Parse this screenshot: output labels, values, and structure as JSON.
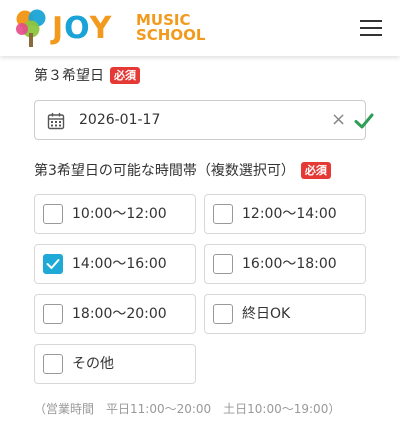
{
  "header": {
    "logo_main": [
      "J",
      "O",
      "Y"
    ],
    "logo_sub": [
      "MUSIC",
      "SCHOOL"
    ],
    "menu_icon": "hamburger-menu-icon"
  },
  "third_choice_date": {
    "label": "第３希望日",
    "required_badge": "必須",
    "value": "2026-01-17",
    "clear_label": "×",
    "calendar_icon": "calendar-icon",
    "valid_icon": "checkmark-icon"
  },
  "time_slots": {
    "label": "第3希望日の可能な時間帯（複数選択可）",
    "required_badge": "必須",
    "options": [
      {
        "label": "10:00〜12:00",
        "checked": false
      },
      {
        "label": "12:00〜14:00",
        "checked": false
      },
      {
        "label": "14:00〜16:00",
        "checked": true
      },
      {
        "label": "16:00〜18:00",
        "checked": false
      },
      {
        "label": "18:00〜20:00",
        "checked": false
      },
      {
        "label": "終日OK",
        "checked": false
      },
      {
        "label": "その他",
        "checked": false
      }
    ],
    "business_hours_note": "（営業時間　平日11:00〜20:00　土日10:00〜19:00）"
  },
  "colors": {
    "accent": "#1fa9d6",
    "required": "#e53935",
    "valid": "#2e9e57",
    "logo_orange": "#f29a1e",
    "logo_blue": "#1aa3d6"
  }
}
